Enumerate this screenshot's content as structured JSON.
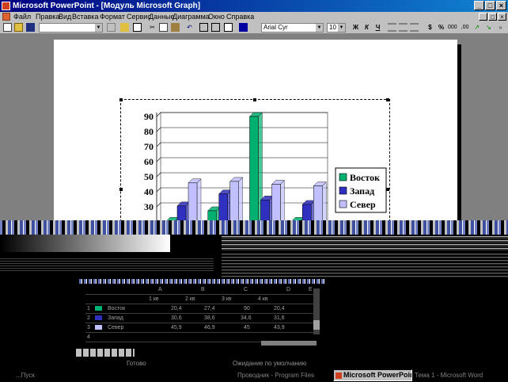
{
  "window": {
    "title": "Microsoft PowerPoint - [Модуль Microsoft Graph]",
    "buttons": {
      "minimize": "_",
      "maximize": "□",
      "close": "×"
    }
  },
  "menu": {
    "items": [
      "Файл",
      "Правка",
      "Вид",
      "Вставка",
      "Формат",
      "Сервис",
      "Данные",
      "Диаграмма",
      "Окно",
      "Справка"
    ]
  },
  "toolbar": {
    "font_name": "Arial Cyr",
    "font_size": "10",
    "bold": "Ж",
    "italic": "К",
    "underline": "Ч"
  },
  "chart_data": {
    "type": "bar",
    "categories": [
      "1 кв",
      "2 кв",
      "3 кв",
      "4 кв"
    ],
    "series": [
      {
        "name": "Восток",
        "values": [
          20.4,
          27.4,
          90,
          20.4
        ],
        "color": "#00b070"
      },
      {
        "name": "Запад",
        "values": [
          30.6,
          38.6,
          34.6,
          31.6
        ],
        "color": "#3030c0"
      },
      {
        "name": "Север",
        "values": [
          45.9,
          46.9,
          45,
          43.9
        ],
        "color": "#c0c0ff"
      }
    ],
    "yticks": [
      30,
      40,
      50,
      60,
      70,
      80,
      90
    ],
    "ylim": [
      0,
      90
    ],
    "legend_position": "right",
    "grid": true
  },
  "datasheet": {
    "columns": [
      "A",
      "B",
      "C",
      "D",
      "E"
    ],
    "headers": [
      "1 кв",
      "2 кв",
      "3 кв",
      "4 кв"
    ],
    "rows": [
      {
        "num": "1",
        "name": "Восток",
        "values": [
          "20,4",
          "27,4",
          "90",
          "20,4"
        ]
      },
      {
        "num": "2",
        "name": "Запад",
        "values": [
          "30,6",
          "38,6",
          "34,6",
          "31,6"
        ]
      },
      {
        "num": "3",
        "name": "Север",
        "values": [
          "45,9",
          "46,9",
          "45",
          "43,9"
        ]
      },
      {
        "num": "4",
        "name": "",
        "values": [
          "",
          "",
          "",
          ""
        ]
      }
    ]
  },
  "status": {
    "left": "Готово",
    "middle": "Ожидание по умолчанию"
  },
  "taskbar": {
    "active": "Microsoft PowerPoint - ...",
    "ghost_left": "...Пуск",
    "ghost_mid": "Проводник - Program Files",
    "ghost_right": "Тема 1 - Microsoft Word"
  }
}
